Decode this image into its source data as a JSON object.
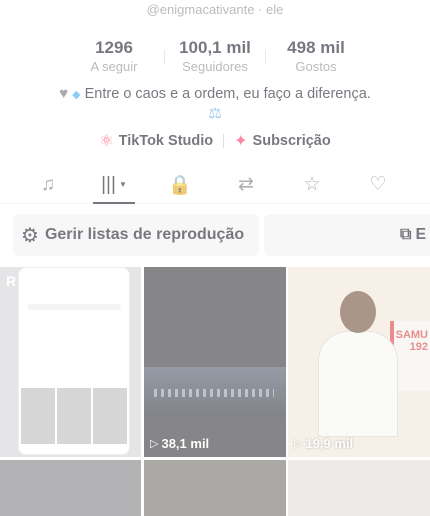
{
  "profile": {
    "handle": "@enigmacativante · ele",
    "stats": [
      {
        "value": "1296",
        "label": "A seguir"
      },
      {
        "value": "100,1 mil",
        "label": "Seguidores"
      },
      {
        "value": "498 mil",
        "label": "Gostos"
      }
    ],
    "bio_line1": "Entre o caos e a ordem, eu faço a diferença.",
    "bio_heart": "♥",
    "bio_diamond": "◆",
    "bio_line2": "⚖",
    "links": [
      {
        "label": "TikTok Studio",
        "icon": "tiktok-studio-icon"
      },
      {
        "label": "Subscrição",
        "icon": "subscription-icon"
      }
    ]
  },
  "tabs": [
    {
      "name": "tab-music",
      "icon": "♫"
    },
    {
      "name": "tab-videos",
      "icon": "|||",
      "active": true
    },
    {
      "name": "tab-private",
      "icon": "🔒"
    },
    {
      "name": "tab-reposts",
      "icon": "⇄"
    },
    {
      "name": "tab-favorites",
      "icon": "☆"
    },
    {
      "name": "tab-liked",
      "icon": "♡"
    }
  ],
  "playlist": {
    "manage_label": "Gerir listas de reprodução",
    "second_label": "E"
  },
  "videos": [
    {
      "views": "",
      "thumb": "phone-screenshot"
    },
    {
      "views": "38,1 mil",
      "thumb": "city-night"
    },
    {
      "views": "19,9 mil",
      "thumb": "doctor-ambulance"
    }
  ],
  "thumb_text": {
    "r_letter": "R",
    "samu": "SAMU",
    "samu_num": "192"
  }
}
